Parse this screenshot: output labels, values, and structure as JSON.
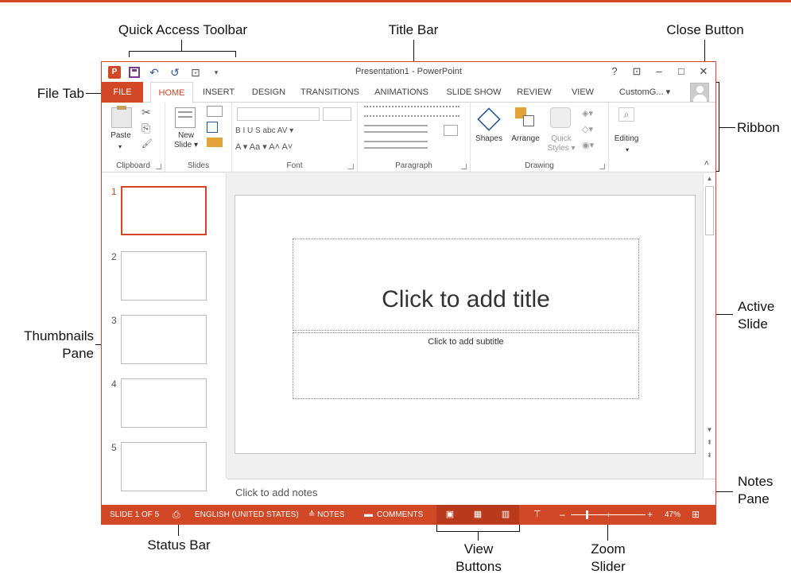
{
  "callouts": {
    "quick_access_toolbar": "Quick Access Toolbar",
    "title_bar": "Title Bar",
    "close_button": "Close Button",
    "file_tab": "File Tab",
    "ribbon": "Ribbon",
    "thumbnails_pane_line1": "Thumbnails",
    "thumbnails_pane_line2": "Pane",
    "active_slide_line1": "Active",
    "active_slide_line2": "Slide",
    "notes_pane_line1": "Notes",
    "notes_pane_line2": "Pane",
    "status_bar": "Status Bar",
    "view_buttons_line1": "View",
    "view_buttons_line2": "Buttons",
    "zoom_slider_line1": "Zoom",
    "zoom_slider_line2": "Slider"
  },
  "window": {
    "title": "Presentation1 - PowerPoint",
    "app_icon": "P",
    "controls": [
      "?",
      "⊡",
      "–",
      "□",
      "✕"
    ]
  },
  "tabs": [
    "FILE",
    "HOME",
    "INSERT",
    "DESIGN",
    "TRANSITIONS",
    "ANIMATIONS",
    "SLIDE SHOW",
    "REVIEW",
    "VIEW",
    "CustomG... ▾"
  ],
  "ribbon": {
    "groups": [
      "Clipboard",
      "Slides",
      "Font",
      "Paragraph",
      "Drawing"
    ],
    "paste_label": "Paste",
    "new_slide_label_1": "New",
    "new_slide_label_2": "Slide ▾",
    "font_buttons": "B  I  U  S  abc  AV ▾",
    "font_size_buttons": "A ▾  Aa ▾   A˄  A˅",
    "shapes_label": "Shapes",
    "arrange_label": "Arrange",
    "quick_styles_1": "Quick",
    "quick_styles_2": "Styles ▾",
    "editing_label": "Editing"
  },
  "thumbnails": [
    "1",
    "2",
    "3",
    "4",
    "5"
  ],
  "slide": {
    "title_placeholder": "Click to add title",
    "subtitle_placeholder": "Click to add subtitle"
  },
  "notes": {
    "placeholder": "Click to add notes"
  },
  "status": {
    "slide_count": "SLIDE 1 OF 5",
    "language": "ENGLISH (UNITED STATES)",
    "notes": "≙ NOTES",
    "comments": "COMMENTS",
    "zoom": "47%",
    "zoom_level": 0.47
  },
  "icons": {
    "undo": "↶",
    "redo": "↺",
    "start": "⊡",
    "cut": "✂",
    "copy": "⎘",
    "brush": "🖌",
    "find": "⌕"
  },
  "colors": {
    "accent": "#d24726",
    "status_dark": "#b8391b"
  }
}
